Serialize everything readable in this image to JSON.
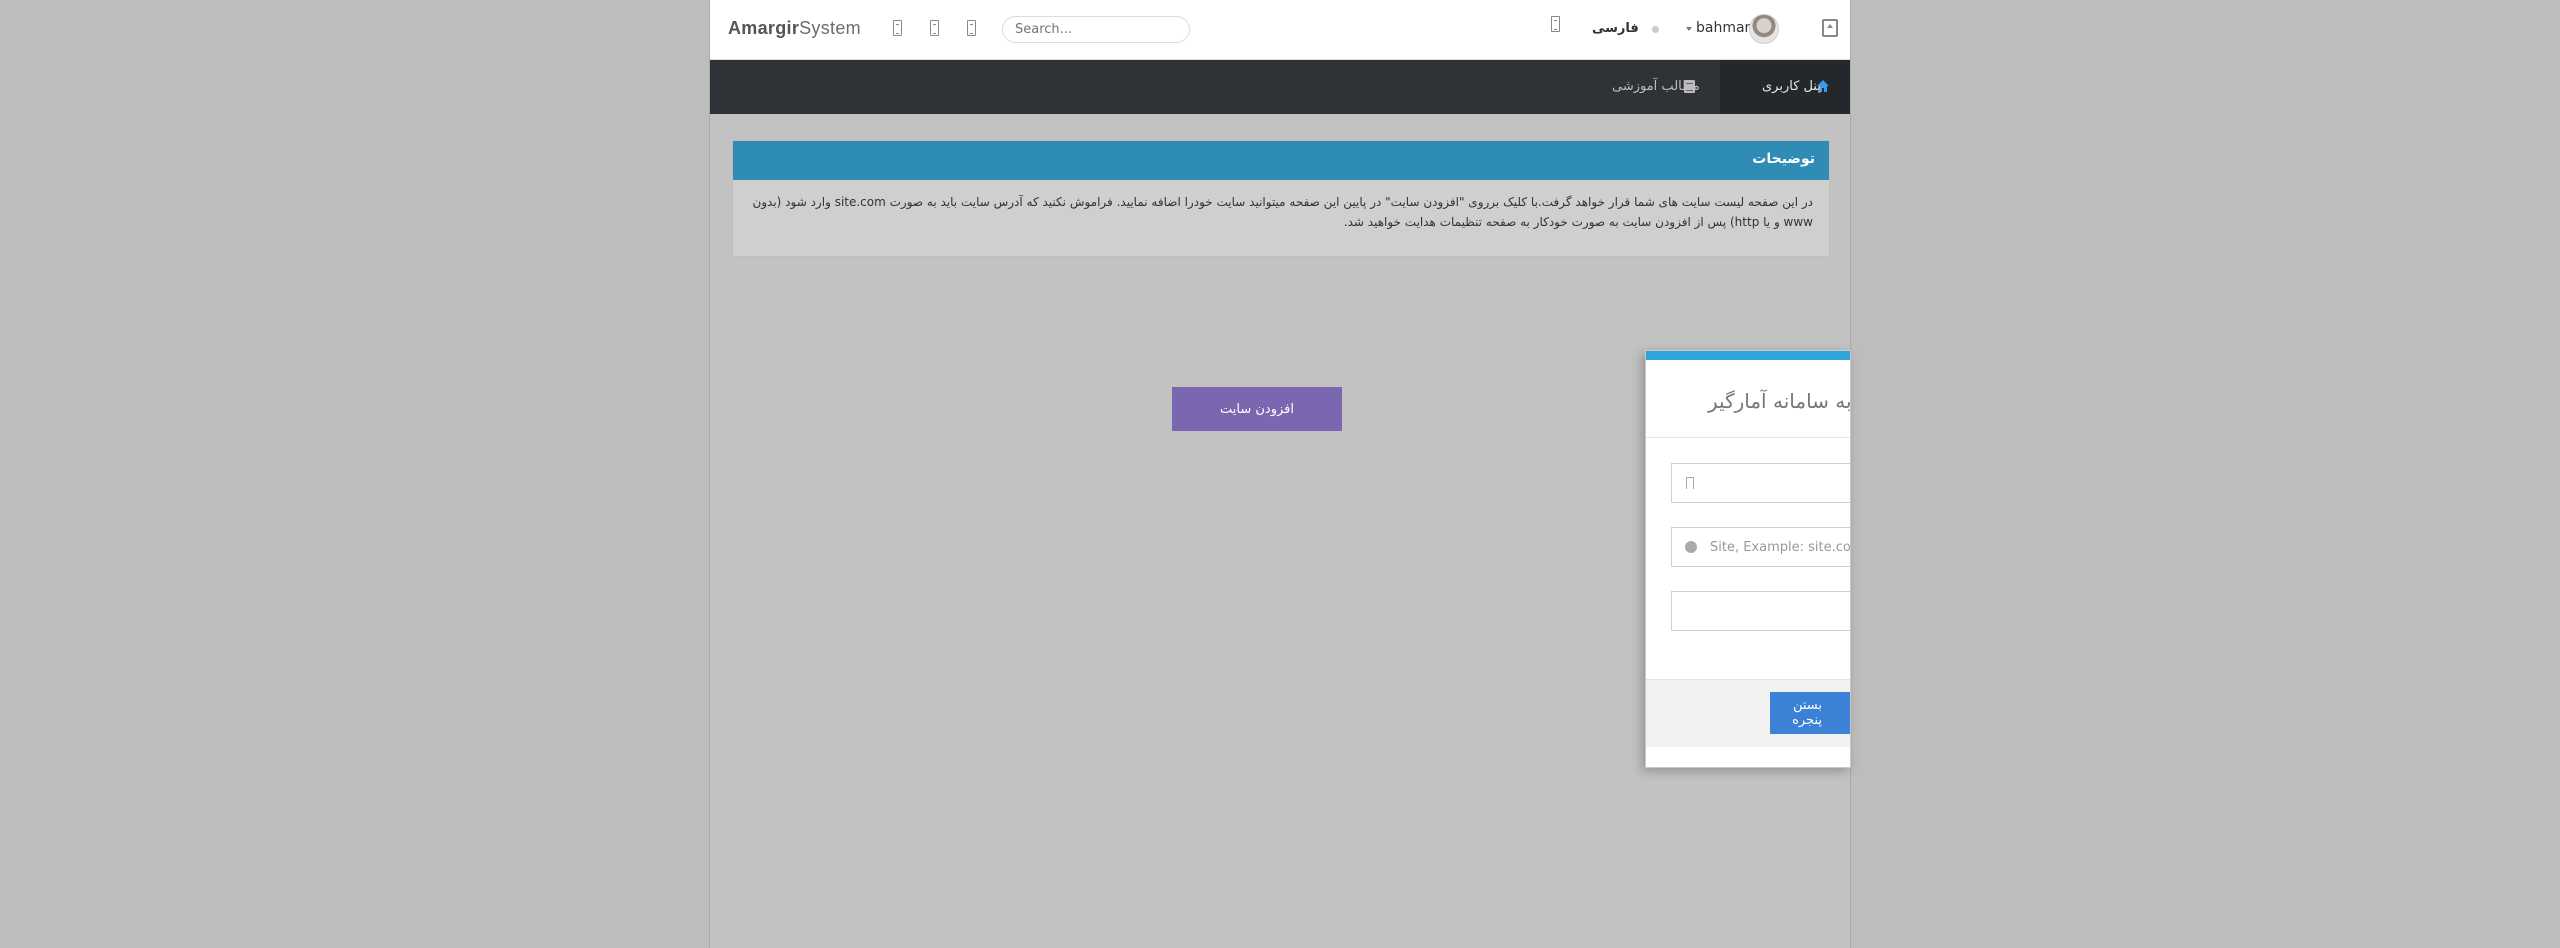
{
  "header": {
    "brand_bold": "Amargir",
    "brand_light": "System",
    "search_placeholder": "Search...",
    "language": "فارسی",
    "username": "bahman"
  },
  "nav": {
    "items": [
      {
        "label": "پنل کاربری",
        "active": true
      },
      {
        "label": "مطالب آموزشی",
        "active": false
      }
    ]
  },
  "description": {
    "title": "توضیحات",
    "text": "در این صفحه لیست سایت های شما قرار خواهد گرفت.با کلیک برروی \"افزودن سایت\" در پایین این صفحه میتوانید سایت خودرا اضافه نمایید. فراموش نکنید که آدرس سایت باید به صورت site.com وارد شود (بدون www و یا http) پس از افزودن سایت به صورت خودکار به صفحه تنظیمات هدایت خواهید شد."
  },
  "main": {
    "add_site_label": "افزودن سایت"
  },
  "modal": {
    "title": "افزودن سایت به سامانه آمارگیر",
    "site_placeholder": "Site, Example: site.com",
    "close_label": "بستن پنجره"
  },
  "colors": {
    "desc_header": "#2e8cb5",
    "add_button": "#7b66b0",
    "close_button": "#3b82d6",
    "modal_accent": "#2fa4dc",
    "navbar": "#2f3338"
  }
}
